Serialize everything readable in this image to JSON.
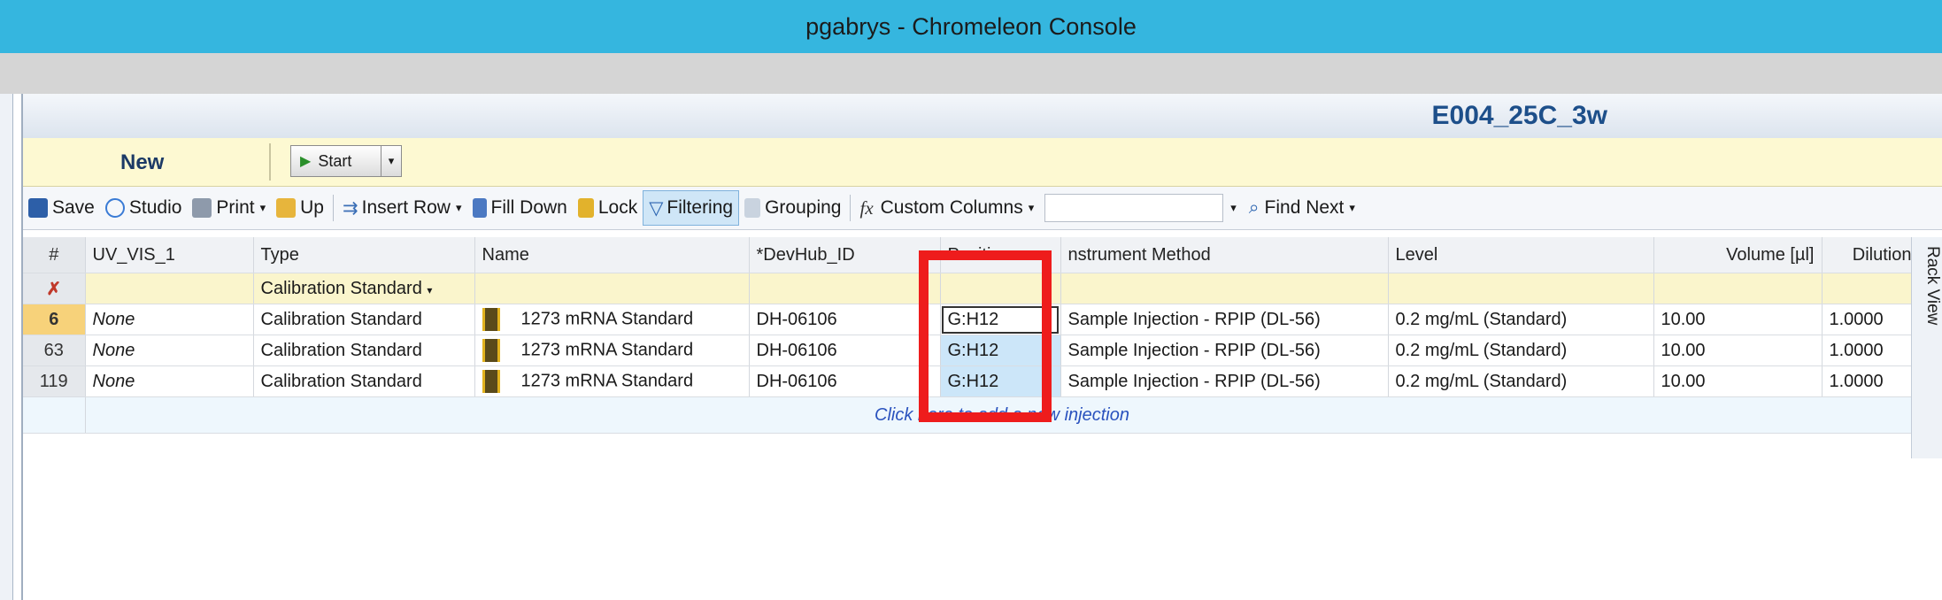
{
  "window": {
    "title": "pgabrys - Chromeleon Console"
  },
  "sequence": {
    "title": "E004_25C_3w"
  },
  "action_bar": {
    "new_label": "New",
    "start_label": "Start"
  },
  "toolbar": {
    "save": "Save",
    "studio": "Studio",
    "print": "Print",
    "up": "Up",
    "insert_row": "Insert Row",
    "fill_down": "Fill Down",
    "lock": "Lock",
    "filtering": "Filtering",
    "grouping": "Grouping",
    "custom_columns": "Custom Columns",
    "find_next": "Find Next",
    "find_value": ""
  },
  "grid": {
    "columns": [
      "#",
      "UV_VIS_1",
      "Type",
      "Name",
      "*DevHub_ID",
      "Position",
      "nstrument Method",
      "Level",
      "Volume [µl]",
      "Dilution"
    ],
    "filter_row": {
      "type": "Calibration Standard"
    },
    "rows": [
      {
        "num": "6",
        "uv": "None",
        "type": "Calibration Standard",
        "name": "1273 mRNA Standard",
        "devhub": "DH-06106",
        "position": "G:H12",
        "method": "Sample Injection - RPIP (DL-56)",
        "level": "0.2 mg/mL (Standard)",
        "volume": "10.00",
        "dilution": "1.0000"
      },
      {
        "num": "63",
        "uv": "None",
        "type": "Calibration Standard",
        "name": "1273 mRNA Standard",
        "devhub": "DH-06106",
        "position": "G:H12",
        "method": "Sample Injection - RPIP (DL-56)",
        "level": "0.2 mg/mL (Standard)",
        "volume": "10.00",
        "dilution": "1.0000"
      },
      {
        "num": "119",
        "uv": "None",
        "type": "Calibration Standard",
        "name": "1273 mRNA Standard",
        "devhub": "DH-06106",
        "position": "G:H12",
        "method": "Sample Injection - RPIP (DL-56)",
        "level": "0.2 mg/mL (Standard)",
        "volume": "10.00",
        "dilution": "1.0000"
      }
    ],
    "add_injection": "Click here to add a new injection"
  },
  "side_panel": {
    "rack_view": "Rack View"
  },
  "colors": {
    "title_bar": "#35b6df",
    "highlight": "#ee1c1c",
    "selection": "#cce6f9"
  }
}
